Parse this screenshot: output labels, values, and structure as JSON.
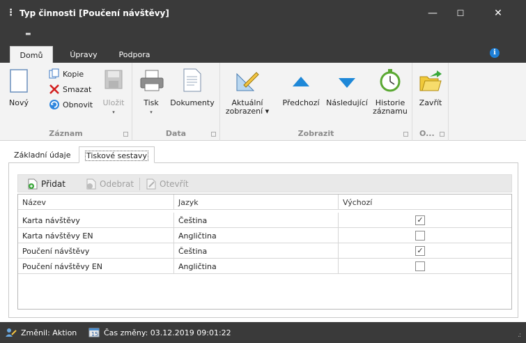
{
  "window": {
    "title": "Typ činnosti [Poučení návštěvy]",
    "minimize": "—",
    "maximize": "☐",
    "close": "✕"
  },
  "tabs": [
    {
      "label": "Domů",
      "active": true
    },
    {
      "label": "Úpravy"
    },
    {
      "label": "Podpora"
    }
  ],
  "ribbon": {
    "zaznam": {
      "label": "Záznam",
      "novy": "Nový",
      "kopie": "Kopie",
      "smazat": "Smazat",
      "obnovit": "Obnovit",
      "ulozit": "Uložit"
    },
    "data": {
      "label": "Data",
      "tisk": "Tisk",
      "dokumenty": "Dokumenty"
    },
    "zobrazit": {
      "label": "Zobrazit",
      "aktualni_1": "Aktuální",
      "aktualni_2": "zobrazení ▾",
      "predchozi": "Předchozí",
      "nasledujici": "Následující",
      "historie_1": "Historie",
      "historie_2": "záznamu"
    },
    "o": {
      "label": "O...",
      "zavrit": "Zavřít"
    }
  },
  "subtabs": [
    {
      "label": "Základní údaje"
    },
    {
      "label": "Tiskové sestavy",
      "active": true
    }
  ],
  "toolbar": {
    "pridat": "Přidat",
    "odebrat": "Odebrat",
    "otevrit": "Otevřít"
  },
  "table": {
    "columns": [
      "Název",
      "Jazyk",
      "Výchozí"
    ],
    "rows": [
      {
        "nazev": "Karta návštěvy",
        "jazyk": "Čeština",
        "vychozi": true
      },
      {
        "nazev": "Karta návštěvy EN",
        "jazyk": "Angličtina",
        "vychozi": false
      },
      {
        "nazev": "Poučení návštěvy",
        "jazyk": "Čeština",
        "vychozi": true
      },
      {
        "nazev": "Poučení návštěvy EN",
        "jazyk": "Angličtina",
        "vychozi": false
      }
    ]
  },
  "status": {
    "zmenil": "Změnil: Aktion",
    "cas": "Čas změny: 03.12.2019 09:01:22"
  },
  "colors": {
    "dark_chrome": "#3a3a3a",
    "accent_blue": "#1e7fd6",
    "delete_red": "#d22020"
  }
}
